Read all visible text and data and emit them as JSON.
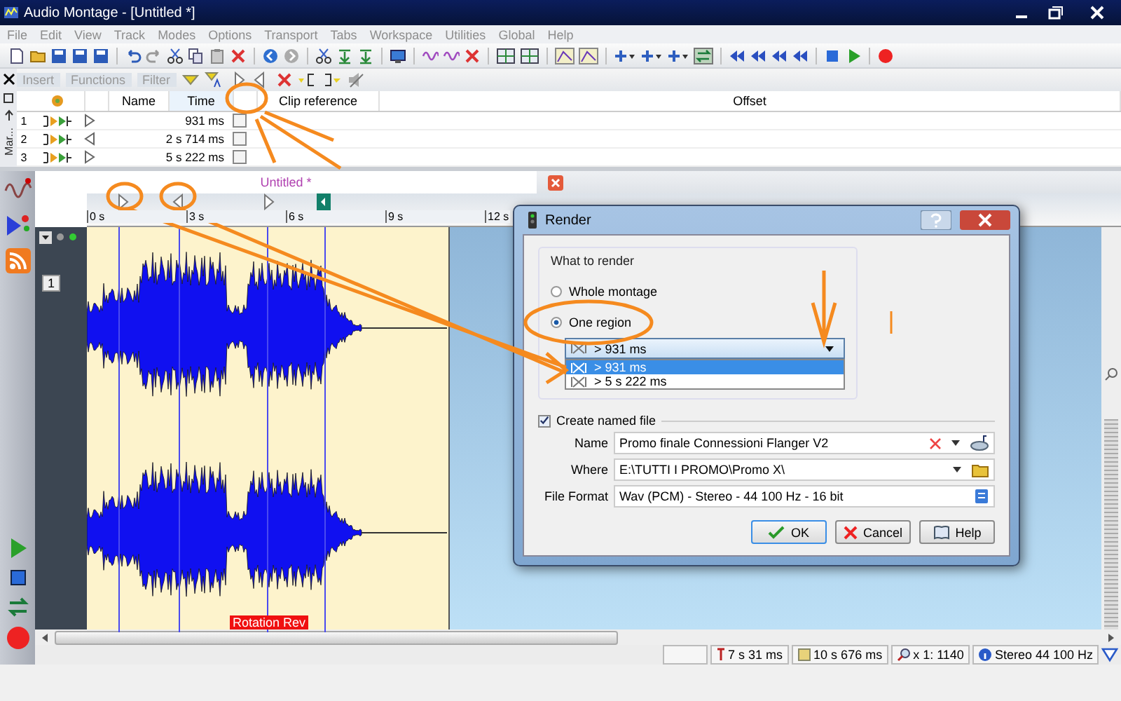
{
  "window": {
    "title": "Audio Montage - [Untitled *]"
  },
  "menu": [
    "File",
    "Edit",
    "View",
    "Track",
    "Modes",
    "Options",
    "Transport",
    "Tabs",
    "Workspace",
    "Utilities",
    "Global",
    "Help"
  ],
  "markers_panel": {
    "side_label": "Mar...",
    "tabs": [
      "Insert",
      "Functions",
      "Filter"
    ],
    "columns": [
      "Name",
      "Time",
      "Clip reference",
      "Offset"
    ],
    "rows": [
      {
        "index": "1",
        "kind": "start",
        "time": "931 ms",
        "checked": false
      },
      {
        "index": "2",
        "kind": "end",
        "time": "2 s 714 ms",
        "checked": false
      },
      {
        "index": "3",
        "kind": "start",
        "time": "5 s 222 ms",
        "checked": false
      }
    ]
  },
  "montage": {
    "tab_title": "Untitled *",
    "ruler_labels": [
      "0 s",
      "3 s",
      "6 s",
      "9 s",
      "12 s"
    ],
    "track_number": "1",
    "region_label": "Rotation Rev"
  },
  "dialog": {
    "title": "Render",
    "group_title": "What to render",
    "options": [
      {
        "label": "Whole montage",
        "selected": false
      },
      {
        "label": "One region",
        "selected": true
      }
    ],
    "region_value": "> 931 ms",
    "region_items": [
      {
        "label": "> 931 ms",
        "selected": true
      },
      {
        "label": "> 5 s 222 ms",
        "selected": false
      }
    ],
    "create_file": {
      "label": "Create named file",
      "checked": true
    },
    "fields": [
      {
        "label": "Name",
        "value": "Promo finale Connessioni Flanger V2",
        "kind": "name"
      },
      {
        "label": "Where",
        "value": "E:\\TUTTI I PROMO\\Promo X\\",
        "kind": "folder"
      },
      {
        "label": "File Format",
        "value": "Wav (PCM) - Stereo - 44 100 Hz - 16 bit",
        "kind": "format"
      }
    ],
    "buttons": [
      {
        "label": "OK",
        "kind": "ok"
      },
      {
        "label": "Cancel",
        "kind": "cancel"
      },
      {
        "label": "Help",
        "kind": "help"
      }
    ]
  },
  "status_bar": [
    {
      "text": "7 s 31 ms",
      "kind": "cursor"
    },
    {
      "text": "10 s 676 ms",
      "kind": "length"
    },
    {
      "text": "x 1: 1140",
      "kind": "zoom"
    },
    {
      "text": "Stereo 44 100 Hz",
      "kind": "info"
    }
  ]
}
